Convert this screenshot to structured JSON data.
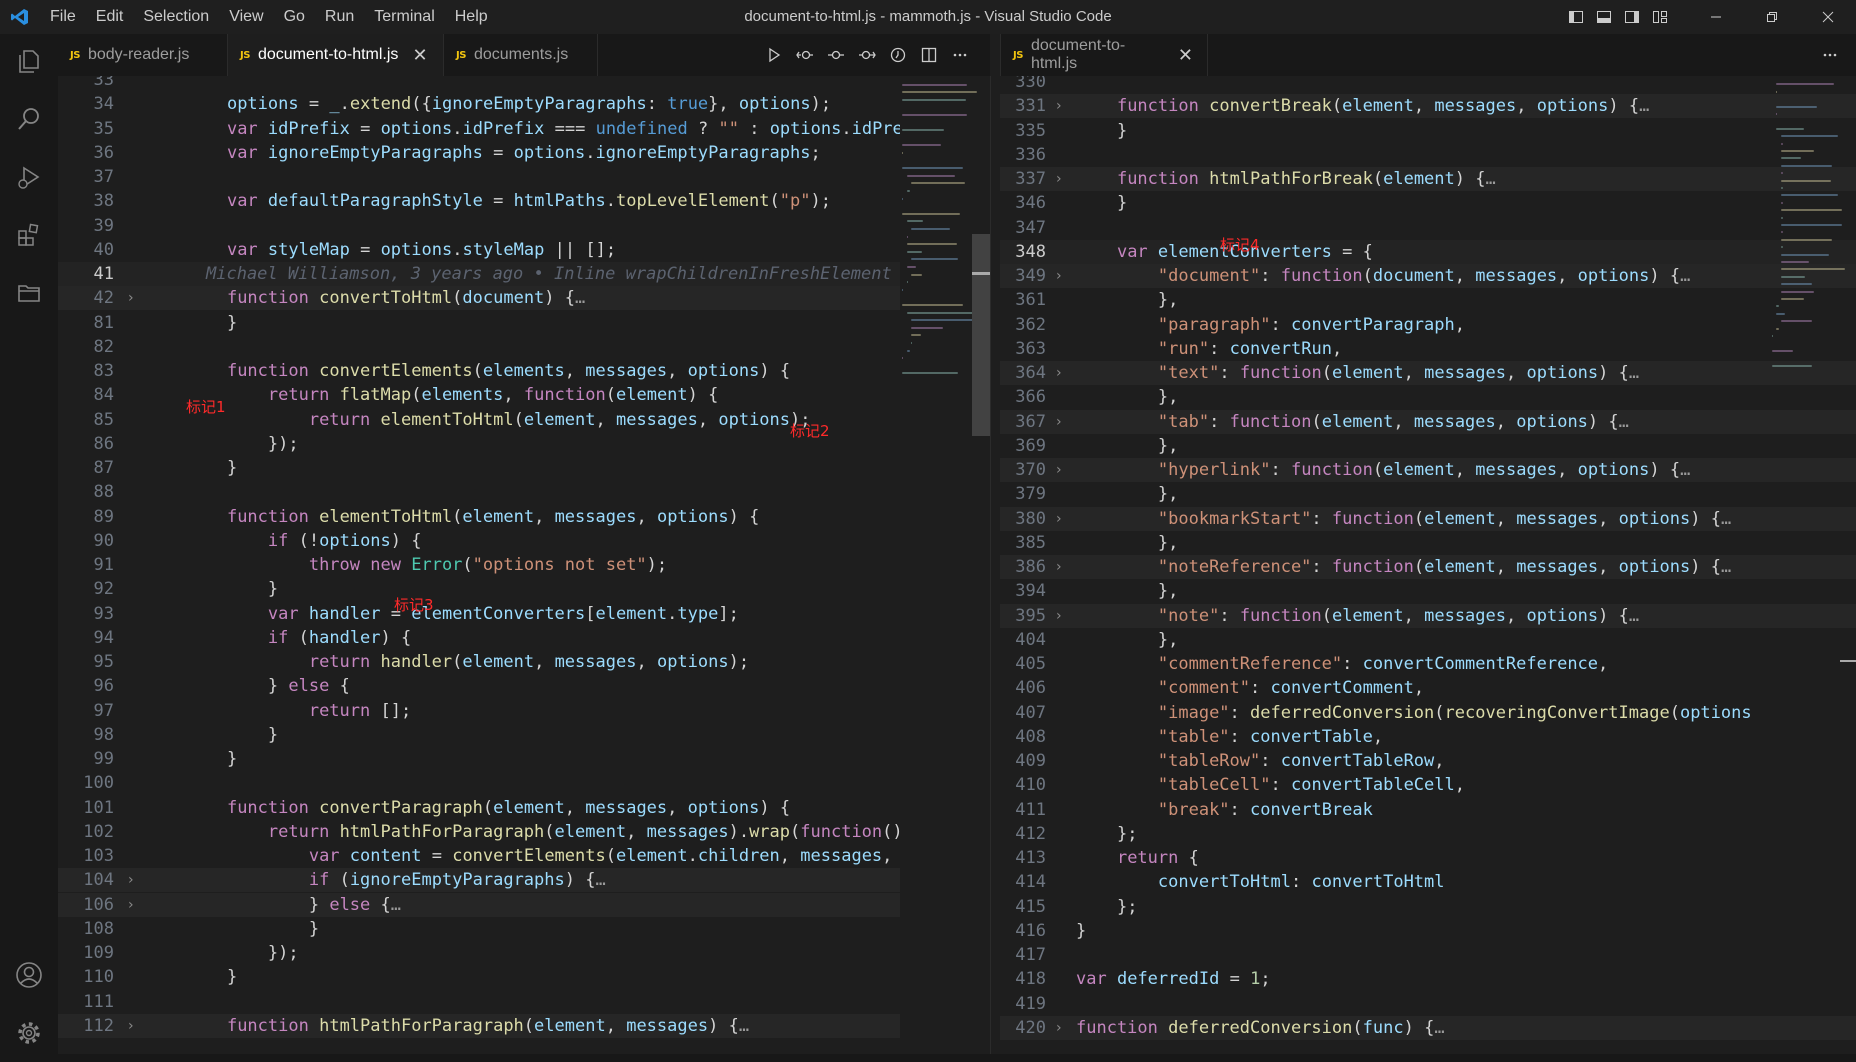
{
  "window_title": "document-to-html.js - mammoth.js - Visual Studio Code",
  "menu": [
    "File",
    "Edit",
    "Selection",
    "View",
    "Go",
    "Run",
    "Terminal",
    "Help"
  ],
  "icons": {
    "app": "vscode-logo-icon",
    "activity": [
      "explorer-icon",
      "search-icon",
      "run-debug-icon",
      "extensions-icon",
      "folder-icon",
      "account-icon",
      "settings-gear-icon"
    ],
    "layout": [
      "toggle-primary-sidebar-icon",
      "toggle-panel-icon",
      "toggle-secondary-sidebar-icon",
      "customize-layout-icon"
    ],
    "editor_actions": [
      "run-icon",
      "go-back-icon",
      "commit-icon",
      "go-forward-icon",
      "timeline-icon",
      "split-editor-icon",
      "more-actions-icon"
    ]
  },
  "colors": {
    "keyword": "#c586c0",
    "function": "#dcdcaa",
    "variable": "#9cdcfe",
    "string": "#ce9178",
    "number": "#b5cea8",
    "class": "#4ec9b0",
    "annotation": "#ff2a2a"
  },
  "left_tabs": [
    {
      "label": "body-reader.js",
      "active": false
    },
    {
      "label": "document-to-html.js",
      "active": true,
      "close": "✕"
    },
    {
      "label": "documents.js",
      "active": false
    }
  ],
  "right_tabs": [
    {
      "label": "document-to-html.js",
      "active": false,
      "close": "✕"
    }
  ],
  "js_badge": "JS",
  "blame": "Michael Williamson, 3 years ago • Inline wrapChildrenInFreshElement",
  "annotations": {
    "a1": "标记1",
    "a2": "标记2",
    "a3": "标记3",
    "a4": "标记4"
  },
  "left_editor": {
    "lines": [
      {
        "n": "33",
        "t": ""
      },
      {
        "n": "34",
        "t": "    options = _.extend({ignoreEmptyParagraphs: true}, options);"
      },
      {
        "n": "35",
        "t": "    var idPrefix = options.idPrefix === undefined ? \"\" : options.idPrefi"
      },
      {
        "n": "36",
        "t": "    var ignoreEmptyParagraphs = options.ignoreEmptyParagraphs;"
      },
      {
        "n": "37",
        "t": ""
      },
      {
        "n": "38",
        "t": "    var defaultParagraphStyle = htmlPaths.topLevelElement(\"p\");"
      },
      {
        "n": "39",
        "t": ""
      },
      {
        "n": "40",
        "t": "    var styleMap = options.styleMap || [];"
      },
      {
        "n": "41",
        "t": ""
      },
      {
        "n": "42",
        "t": "    function convertToHtml(document) {…",
        "fold": "›"
      },
      {
        "n": "81",
        "t": "    }"
      },
      {
        "n": "82",
        "t": ""
      },
      {
        "n": "83",
        "t": "    function convertElements(elements, messages, options) {"
      },
      {
        "n": "84",
        "t": "        return flatMap(elements, function(element) {"
      },
      {
        "n": "85",
        "t": "            return elementToHtml(element, messages, options);"
      },
      {
        "n": "86",
        "t": "        });"
      },
      {
        "n": "87",
        "t": "    }"
      },
      {
        "n": "88",
        "t": ""
      },
      {
        "n": "89",
        "t": "    function elementToHtml(element, messages, options) {"
      },
      {
        "n": "90",
        "t": "        if (!options) {"
      },
      {
        "n": "91",
        "t": "            throw new Error(\"options not set\");"
      },
      {
        "n": "92",
        "t": "        }"
      },
      {
        "n": "93",
        "t": "        var handler = elementConverters[element.type];"
      },
      {
        "n": "94",
        "t": "        if (handler) {"
      },
      {
        "n": "95",
        "t": "            return handler(element, messages, options);"
      },
      {
        "n": "96",
        "t": "        } else {"
      },
      {
        "n": "97",
        "t": "            return [];"
      },
      {
        "n": "98",
        "t": "        }"
      },
      {
        "n": "99",
        "t": "    }"
      },
      {
        "n": "100",
        "t": ""
      },
      {
        "n": "101",
        "t": "    function convertParagraph(element, messages, options) {"
      },
      {
        "n": "102",
        "t": "        return htmlPathForParagraph(element, messages).wrap(function() {"
      },
      {
        "n": "103",
        "t": "            var content = convertElements(element.children, messages, op"
      },
      {
        "n": "104",
        "t": "            if (ignoreEmptyParagraphs) {…",
        "fold": "›"
      },
      {
        "n": "106",
        "t": "            } else {…",
        "fold": "›"
      },
      {
        "n": "108",
        "t": "            }"
      },
      {
        "n": "109",
        "t": "        });"
      },
      {
        "n": "110",
        "t": "    }"
      },
      {
        "n": "111",
        "t": ""
      },
      {
        "n": "112",
        "t": "    function htmlPathForParagraph(element, messages) {…",
        "fold": "›"
      }
    ]
  },
  "right_editor": {
    "lines": [
      {
        "n": "330",
        "t": ""
      },
      {
        "n": "331",
        "t": "    function convertBreak(element, messages, options) {…",
        "fold": "›"
      },
      {
        "n": "335",
        "t": "    }"
      },
      {
        "n": "336",
        "t": ""
      },
      {
        "n": "337",
        "t": "    function htmlPathForBreak(element) {…",
        "fold": "›"
      },
      {
        "n": "346",
        "t": "    }"
      },
      {
        "n": "347",
        "t": ""
      },
      {
        "n": "348",
        "t": "    var elementConverters = {"
      },
      {
        "n": "349",
        "t": "        \"document\": function(document, messages, options) {…",
        "fold": "›"
      },
      {
        "n": "361",
        "t": "        },"
      },
      {
        "n": "362",
        "t": "        \"paragraph\": convertParagraph,"
      },
      {
        "n": "363",
        "t": "        \"run\": convertRun,"
      },
      {
        "n": "364",
        "t": "        \"text\": function(element, messages, options) {…",
        "fold": "›"
      },
      {
        "n": "366",
        "t": "        },"
      },
      {
        "n": "367",
        "t": "        \"tab\": function(element, messages, options) {…",
        "fold": "›"
      },
      {
        "n": "369",
        "t": "        },"
      },
      {
        "n": "370",
        "t": "        \"hyperlink\": function(element, messages, options) {…",
        "fold": "›"
      },
      {
        "n": "379",
        "t": "        },"
      },
      {
        "n": "380",
        "t": "        \"bookmarkStart\": function(element, messages, options) {…",
        "fold": "›"
      },
      {
        "n": "385",
        "t": "        },"
      },
      {
        "n": "386",
        "t": "        \"noteReference\": function(element, messages, options) {…",
        "fold": "›"
      },
      {
        "n": "394",
        "t": "        },"
      },
      {
        "n": "395",
        "t": "        \"note\": function(element, messages, options) {…",
        "fold": "›"
      },
      {
        "n": "404",
        "t": "        },"
      },
      {
        "n": "405",
        "t": "        \"commentReference\": convertCommentReference,"
      },
      {
        "n": "406",
        "t": "        \"comment\": convertComment,"
      },
      {
        "n": "407",
        "t": "        \"image\": deferredConversion(recoveringConvertImage(options"
      },
      {
        "n": "408",
        "t": "        \"table\": convertTable,"
      },
      {
        "n": "409",
        "t": "        \"tableRow\": convertTableRow,"
      },
      {
        "n": "410",
        "t": "        \"tableCell\": convertTableCell,"
      },
      {
        "n": "411",
        "t": "        \"break\": convertBreak"
      },
      {
        "n": "412",
        "t": "    };"
      },
      {
        "n": "413",
        "t": "    return {"
      },
      {
        "n": "414",
        "t": "        convertToHtml: convertToHtml"
      },
      {
        "n": "415",
        "t": "    };"
      },
      {
        "n": "416",
        "t": "}"
      },
      {
        "n": "417",
        "t": ""
      },
      {
        "n": "418",
        "t": "var deferredId = 1;"
      },
      {
        "n": "419",
        "t": ""
      },
      {
        "n": "420",
        "t": "function deferredConversion(func) {…",
        "fold": "›"
      }
    ]
  }
}
